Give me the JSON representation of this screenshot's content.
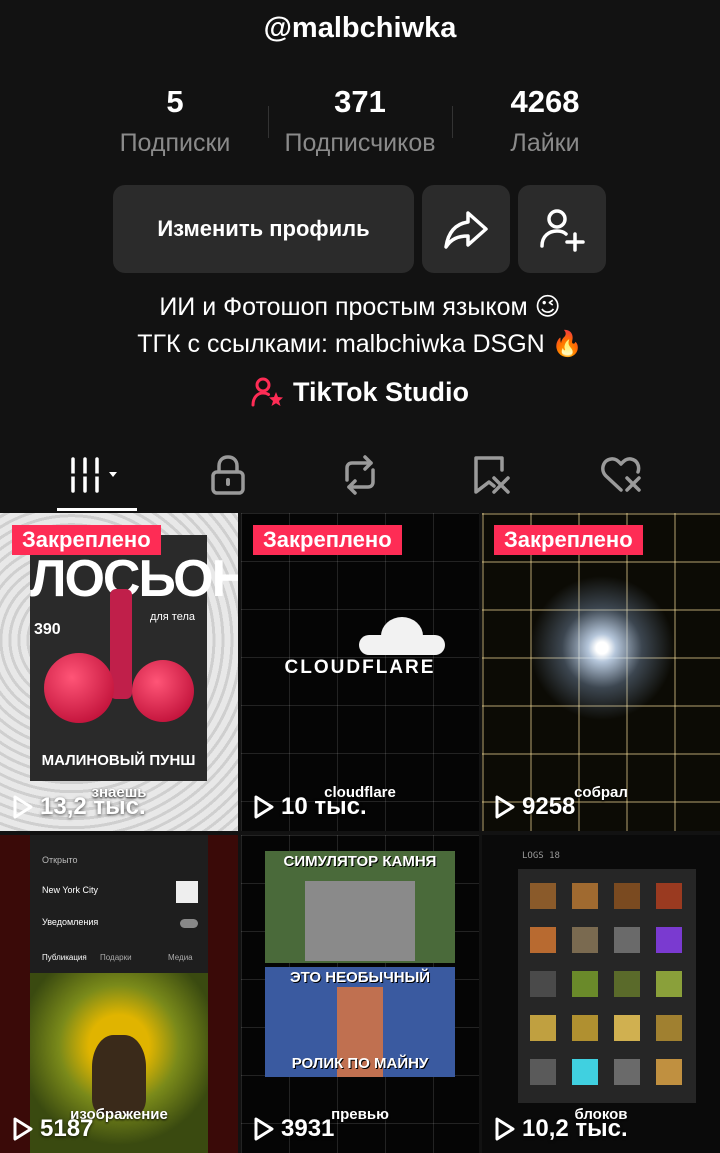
{
  "profile": {
    "username": "@malbchiwka",
    "stats": [
      {
        "value": "5",
        "label": "Подписки"
      },
      {
        "value": "371",
        "label": "Подписчиков"
      },
      {
        "value": "4268",
        "label": "Лайки"
      }
    ],
    "edit_label": "Изменить профиль",
    "bio_line1": "ИИ и Фотошоп простым языком 😉",
    "bio_line2": "ТГК с ссылками: malbchiwka DSGN 🔥",
    "studio_label": "TikTok Studio"
  },
  "tabs": [
    "videos-grid-icon",
    "lock-icon",
    "repost-icon",
    "favorites-icon",
    "liked-icon"
  ],
  "videos": [
    {
      "pinned": "Закреплено",
      "views": "13,2 тыс.",
      "caption": "знаешь",
      "title": "ЛОСЬОН",
      "subtitle": "для тела",
      "bottom": "МАЛИНОВЫЙ ПУНШ",
      "price": "390"
    },
    {
      "pinned": "Закреплено",
      "views": "10 тыс.",
      "caption": "cloudflare",
      "title": "CLOUDFLARE"
    },
    {
      "pinned": "Закреплено",
      "views": "9258",
      "caption": "собрал"
    },
    {
      "views": "5187",
      "caption": "изображение",
      "city": "New York City",
      "notif": "Уведомления",
      "open": "Открыто",
      "tab1": "Публикация",
      "tab2": "Подарки",
      "tab3": "Медиа"
    },
    {
      "views": "3931",
      "caption": "превью",
      "title1": "СИМУЛЯТОР КАМНЯ",
      "title2": "ЭТО НЕОБЫЧНЫЙ",
      "title3": "РОЛИК ПО МАЙНУ"
    },
    {
      "views": "10,2 тыс.",
      "caption": "блоков",
      "logs": "LOGS 18"
    }
  ],
  "colors": {
    "accent": "#fe2c55",
    "background": "#121212",
    "button": "#2b2b2b"
  }
}
